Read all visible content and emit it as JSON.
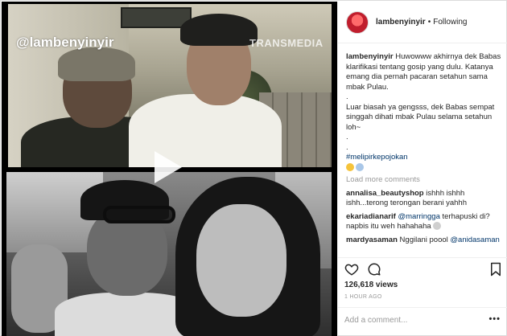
{
  "media": {
    "watermark": "@lambenyinyir",
    "channel_logo": "TRANSMEDIA",
    "play_icon": "play-icon"
  },
  "header": {
    "username": "lambenyinyir",
    "separator": "•",
    "follow_status": "Following",
    "avatar_icon": "avatar"
  },
  "caption": {
    "username": "lambenyinyir",
    "lines": [
      "Huwowww akhirnya dek Babas klarifikasi tentang gosip yang dulu. Katanya emang dia pernah pacaran setahun sama mbak Pulau.",
      ".",
      "Luar biasah ya gengsss, dek Babas sempat singgah dihati mbak Pulau selama setahun loh~",
      ".",
      "."
    ],
    "hashtag": "#melipirkepojokan"
  },
  "load_more": "Load more comments",
  "comments": [
    {
      "user": "annalisa_beautyshop",
      "text": "ishhh ishhh ishh...terong terongan berani yahhh"
    },
    {
      "user": "ekariadianarif",
      "mention": "@marringga",
      "text": "terhapuski di? napbis itu weh hahahaha"
    },
    {
      "user": "mardyasaman",
      "text": "Nggilani poool",
      "mention": "@anidasaman"
    }
  ],
  "actions": {
    "like_icon": "heart-icon",
    "comment_icon": "comment-bubble-icon",
    "save_icon": "bookmark-icon"
  },
  "views": "126,618 views",
  "timestamp": "1 HOUR AGO",
  "add_comment": {
    "placeholder": "Add a comment...",
    "more": "•••"
  }
}
